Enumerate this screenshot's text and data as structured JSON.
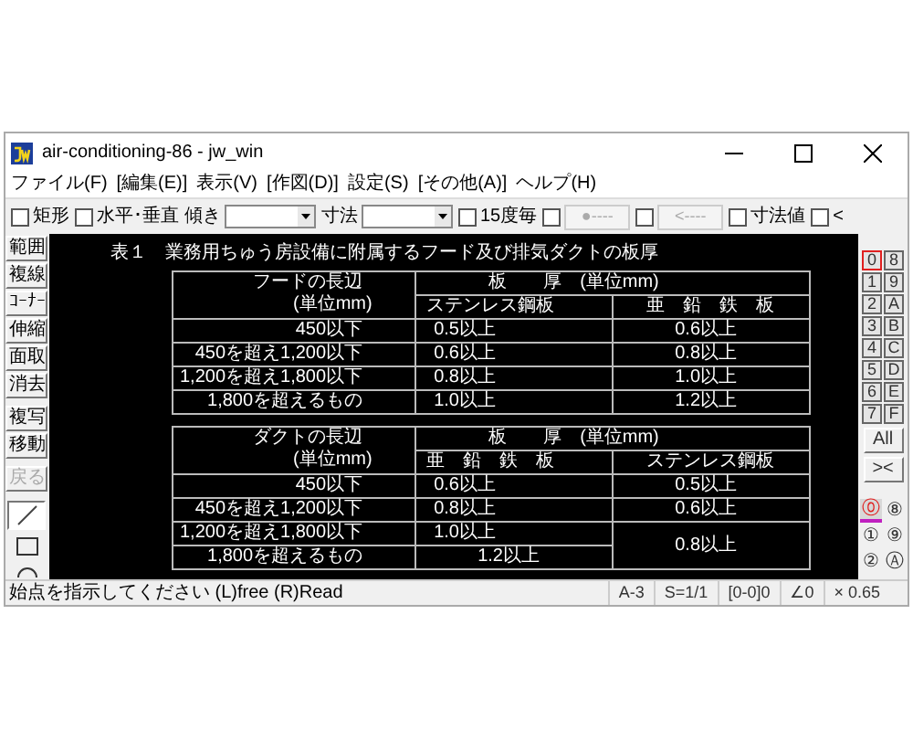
{
  "window": {
    "title": "air-conditioning-86 - jw_win"
  },
  "menu": [
    "ファイル(F)",
    "[編集(E)]",
    "表示(V)",
    "[作図(D)]",
    "設定(S)",
    "[その他(A)]",
    "ヘルプ(H)"
  ],
  "toolbar": [
    {
      "kind": "check",
      "label": "矩形",
      "checked": false
    },
    {
      "kind": "check",
      "label": "水平･垂直",
      "checked": false
    },
    {
      "kind": "combo",
      "label": "傾き"
    },
    {
      "kind": "combo",
      "label": "寸法"
    },
    {
      "kind": "check",
      "label": "15度毎",
      "checked": false
    },
    {
      "kind": "checkbutton",
      "label": "●----",
      "checked": false,
      "disabled": true
    },
    {
      "kind": "checkbutton",
      "label": "<----",
      "checked": false,
      "disabled": true
    },
    {
      "kind": "check",
      "label": "寸法値",
      "checked": false
    },
    {
      "kind": "check",
      "label": "<",
      "checked": false
    }
  ],
  "tools": [
    {
      "label": "範囲",
      "disabled": false
    },
    {
      "label": "複線",
      "disabled": false
    },
    {
      "label": "ｺｰﾅｰ",
      "disabled": false
    },
    {
      "label": "伸縮",
      "disabled": false
    },
    {
      "label": "面取",
      "disabled": false
    },
    {
      "label": "消去",
      "disabled": false
    },
    {
      "label": "複写",
      "disabled": false
    },
    {
      "label": "移動",
      "disabled": false
    },
    {
      "label": "戻る",
      "disabled": true
    }
  ],
  "shape_tools": [
    {
      "kind": "line",
      "selected": true
    },
    {
      "kind": "rectangle",
      "selected": false
    },
    {
      "kind": "circle",
      "selected": false
    }
  ],
  "drawing": {
    "title": "表１　業務用ちゅう房設備に附属するフード及び排気ダクトの板厚",
    "tables": [
      {
        "length_header": [
          "フードの長辺",
          "(単位mm)"
        ],
        "thickness_header": "板　　厚　(単位mm)",
        "sub_headers": [
          "ステンレス鋼板",
          "亜　鉛　鉄　板"
        ],
        "rows": [
          {
            "length": "450以下",
            "values": [
              "0.5以上",
              "0.6以上"
            ]
          },
          {
            "length": "450を超え1,200以下",
            "values": [
              "0.6以上",
              "0.8以上"
            ]
          },
          {
            "length": "1,200を超え1,800以下",
            "values": [
              "0.8以上",
              "1.0以上"
            ]
          },
          {
            "length": "1,800を超えるもの",
            "values": [
              "1.0以上",
              "1.2以上"
            ]
          }
        ]
      },
      {
        "length_header": [
          "ダクトの長辺",
          "(単位mm)"
        ],
        "thickness_header": "板　　厚　(単位mm)",
        "sub_headers": [
          "亜　鉛　鉄　板",
          "ステンレス鋼板"
        ],
        "rows": [
          {
            "length": "450以下",
            "values": [
              "0.6以上",
              "0.5以上"
            ]
          },
          {
            "length": "450を超え1,200以下",
            "values": [
              "0.8以上",
              "0.6以上"
            ]
          },
          {
            "length": "1,200を超え1,800以下",
            "values": [
              "1.0以上",
              "0.8以上"
            ]
          },
          {
            "length": "1,800を超えるもの",
            "values": [
              "1.2以上"
            ]
          }
        ]
      }
    ]
  },
  "layers": [
    {
      "label": "0",
      "selected": true
    },
    {
      "label": "8",
      "selected": false
    },
    {
      "label": "1",
      "selected": false
    },
    {
      "label": "9",
      "selected": false
    },
    {
      "label": "2",
      "selected": false
    },
    {
      "label": "A",
      "selected": false
    },
    {
      "label": "3",
      "selected": false
    },
    {
      "label": "B",
      "selected": false
    },
    {
      "label": "4",
      "selected": false
    },
    {
      "label": "C",
      "selected": false
    },
    {
      "label": "5",
      "selected": false
    },
    {
      "label": "D",
      "selected": false
    },
    {
      "label": "6",
      "selected": false
    },
    {
      "label": "E",
      "selected": false
    },
    {
      "label": "7",
      "selected": false
    },
    {
      "label": "F",
      "selected": false
    }
  ],
  "layer_buttons": [
    "All",
    "><"
  ],
  "layer_groups": [
    {
      "label": "⓪",
      "selected": true
    },
    {
      "label": "⑧",
      "selected": false
    },
    {
      "label": "①",
      "selected": false
    },
    {
      "label": "⑨",
      "selected": false
    },
    {
      "label": "②",
      "selected": false
    },
    {
      "label": "Ⓐ",
      "selected": false
    }
  ],
  "status_bar": {
    "message": "始点を指示してください (L)free (R)Read",
    "fields": [
      "A-3",
      "S=1/1",
      "[0-0]0",
      "∠0",
      "× 0.65"
    ]
  }
}
